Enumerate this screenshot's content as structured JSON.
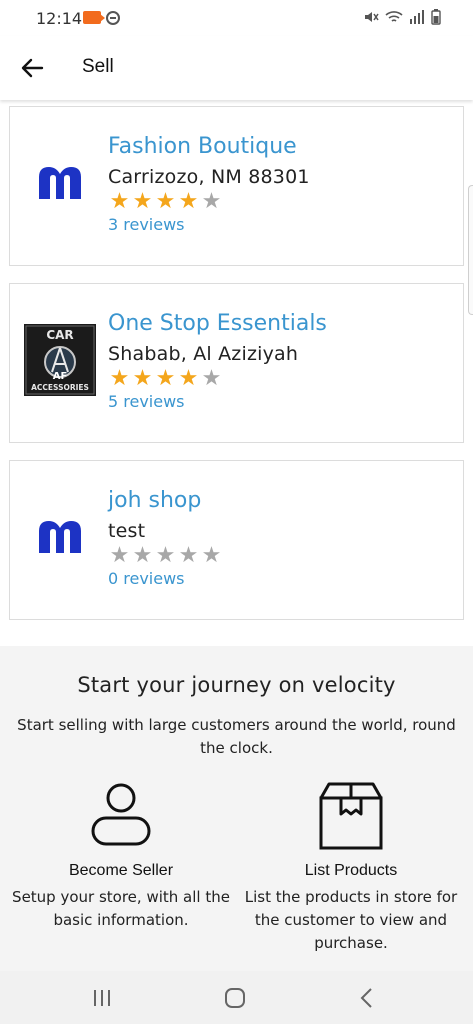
{
  "status_bar": {
    "time": "12:14",
    "icons": [
      "recording-icon",
      "dnd-icon",
      "mute-icon",
      "wifi-icon",
      "signal-icon",
      "battery-icon"
    ]
  },
  "header": {
    "title": "Sell",
    "back_icon": "back-arrow-icon"
  },
  "stores": [
    {
      "name": "Fashion Boutique",
      "address": "Carrizozo, NM 88301",
      "rating": 4,
      "max_rating": 5,
      "reviews": "3 reviews",
      "logo": "m-logo"
    },
    {
      "name": "One Stop Essentials",
      "address": "Shabab, Al Aziziyah",
      "rating": 4,
      "max_rating": 5,
      "reviews": "5 reviews",
      "logo": "car-accessories-logo",
      "logo_text": {
        "top": "CAR",
        "middle": "AF",
        "bottom": "ACCESSORIES"
      }
    },
    {
      "name": "joh shop",
      "address": "test",
      "rating": 0,
      "max_rating": 5,
      "reviews": "0 reviews",
      "logo": "m-logo"
    }
  ],
  "promo": {
    "title": "Start your journey on velocity",
    "subtitle": "Start selling with large customers around the world, round the clock.",
    "features": [
      {
        "icon": "user-icon",
        "title": "Become Seller",
        "desc": "Setup your store, with all the basic information."
      },
      {
        "icon": "box-icon",
        "title": "List Products",
        "desc": "List the products in store for the customer to view and purchase."
      }
    ]
  },
  "nav_bar": {
    "buttons": [
      "recent-apps-icon",
      "home-icon",
      "back-icon"
    ]
  },
  "colors": {
    "link": "#3a95cf",
    "star_on": "#f4a61c",
    "star_off": "#a8a8a8",
    "logo_blue": "#1d33c4",
    "promo_bg": "#f4f4f4"
  }
}
